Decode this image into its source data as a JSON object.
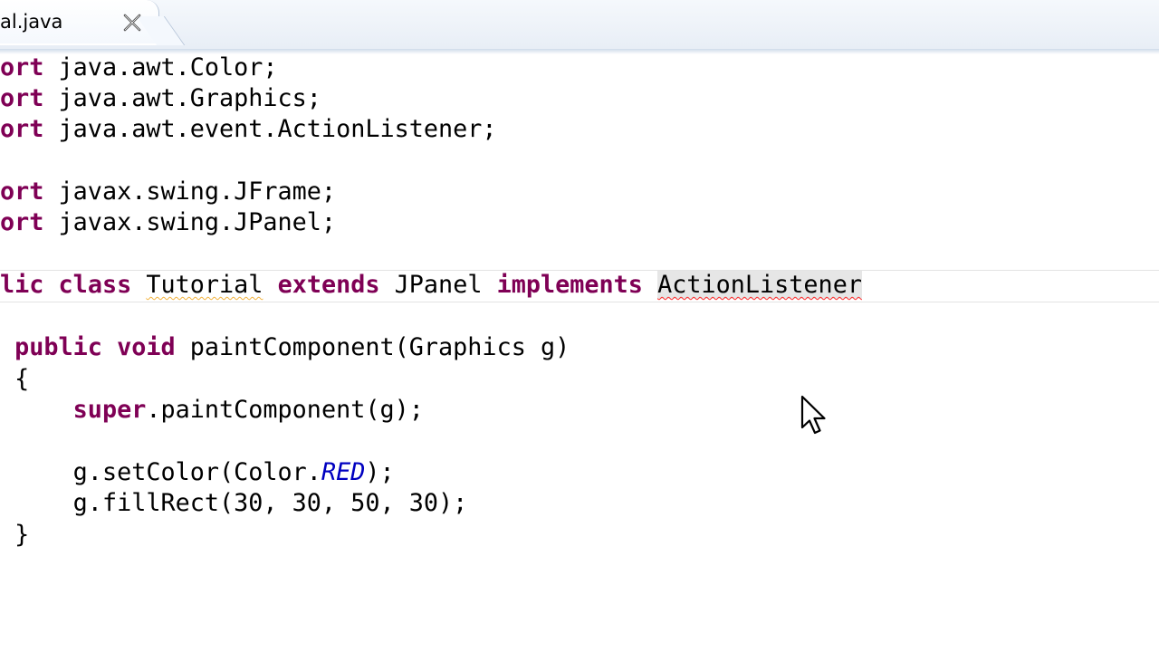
{
  "editor": {
    "tab": {
      "title": "al.java"
    },
    "code": {
      "line1": {
        "kw": "ort",
        "rest": " java.awt.Color;"
      },
      "line2": {
        "kw": "ort",
        "rest": " java.awt.Graphics;"
      },
      "line3": {
        "kw": "ort",
        "rest": " java.awt.event.ActionListener;"
      },
      "line4": {
        "kw": "ort",
        "rest": " javax.swing.JFrame;"
      },
      "line5": {
        "kw": "ort",
        "rest": " javax.swing.JPanel;"
      },
      "line6": {
        "kw1": "lic",
        "kw2": "class",
        "classname": "Tutorial",
        "kw3": "extends",
        "superclass": "JPanel",
        "kw4": "implements",
        "interface": "ActionListener"
      },
      "line7": {
        "kw1": "public",
        "kw2": "void",
        "rest": " paintComponent(Graphics g)"
      },
      "line8": {
        "text": "{"
      },
      "line9": {
        "kw": "super",
        "rest": ".paintComponent(g);"
      },
      "line10": {
        "pre": "g.setColor(Color.",
        "field": "RED",
        "post": ");"
      },
      "line11": {
        "text": "g.fillRect(30, 30, 50, 30);"
      },
      "line12": {
        "text": "}"
      }
    }
  },
  "colors": {
    "keyword": "#7f0055",
    "static_field": "#0000c0",
    "error_underline": "#ff2a2a",
    "warning_underline": "#f2b33d"
  },
  "icons": {
    "tab_close": "close-icon",
    "pointer": "mouse-cursor-icon"
  }
}
